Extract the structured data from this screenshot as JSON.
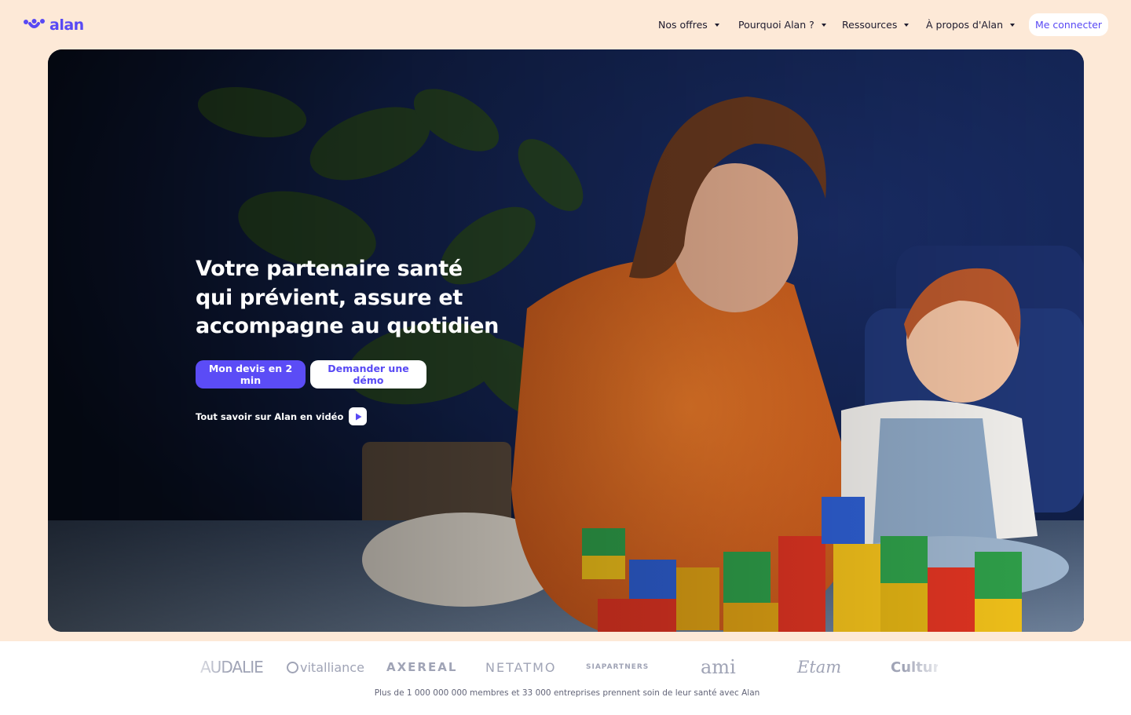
{
  "header": {
    "logo_text": "alan",
    "nav": [
      {
        "label": "Nos offres"
      },
      {
        "label": "Pourquoi Alan ?"
      },
      {
        "label": "Ressources"
      },
      {
        "label": "À propos d'Alan"
      }
    ],
    "login_label": "Me connecter"
  },
  "hero": {
    "title_lines": [
      "Votre partenaire santé",
      "qui prévient, assure et",
      "accompagne au quotidien"
    ],
    "cta_primary": "Mon devis en 2 min",
    "cta_secondary": "Demander une démo",
    "video_link": "Tout savoir sur Alan en vidéo"
  },
  "clients": {
    "logos": [
      "AUDALIE",
      "vitalliance",
      "AXEREAL",
      "NETATMO",
      "SIAPARTNERS",
      "ami",
      "Etam",
      "Cultura"
    ],
    "stat": "Plus de 1 000 000 000 membres et 33 000 entreprises prennent soin de leur santé avec Alan"
  },
  "colors": {
    "brand": "#5849f4",
    "page_bg": "#fde9d7",
    "cta_primary_bg": "#5b4cf6"
  }
}
